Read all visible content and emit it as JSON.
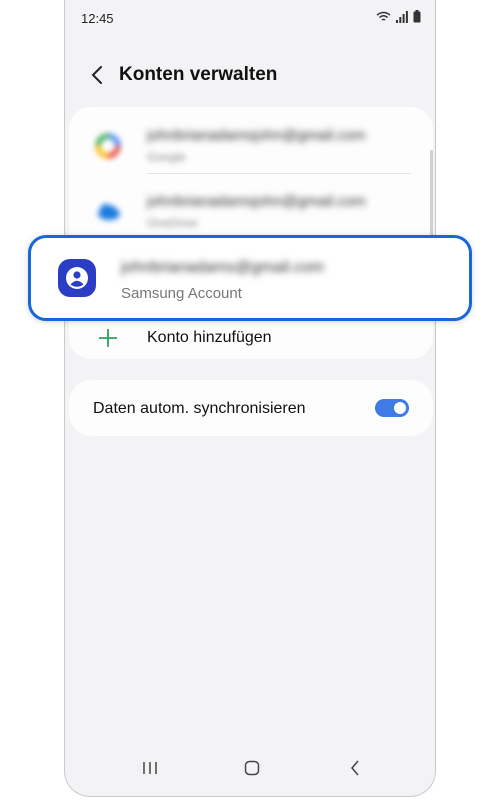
{
  "status_bar": {
    "time": "12:45"
  },
  "header": {
    "title": "Konten verwalten"
  },
  "accounts": [
    {
      "email": "johnbrianadamsjohn@gmail.com",
      "type": "Google",
      "icon": "google-icon"
    },
    {
      "email": "johnbrianadamsjohn@gmail.com",
      "type": "OneDrive",
      "icon": "onedrive-icon"
    }
  ],
  "samsung_account": {
    "email": "johnbrianadams@gmail.com",
    "type": "Samsung Account",
    "icon": "samsung-account-icon"
  },
  "add_account": {
    "label": "Konto hinzufügen"
  },
  "sync": {
    "label": "Daten autom. synchronisieren",
    "enabled": true
  },
  "colors": {
    "accent": "#1668d8",
    "toggle": "#3e7be6",
    "plus": "#2e9e63",
    "background": "#f3f3f5"
  }
}
